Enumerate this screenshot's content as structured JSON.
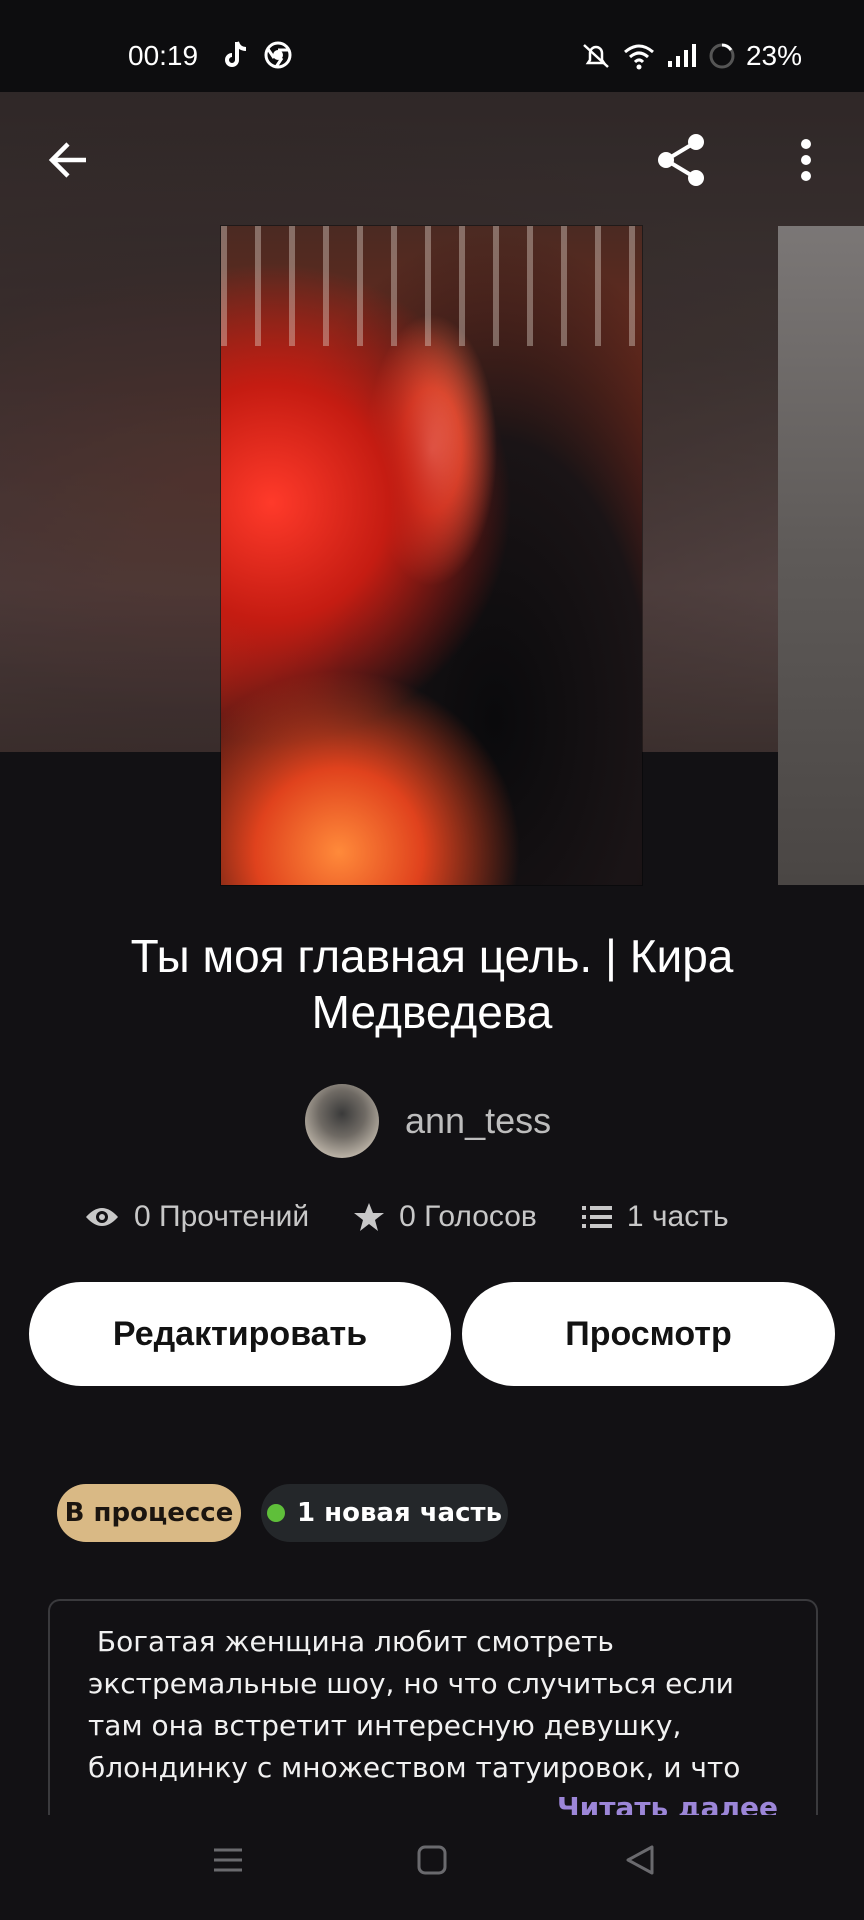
{
  "status_bar": {
    "time": "00:19",
    "battery": "23%"
  },
  "story": {
    "title": "Ты моя главная цель. | Кира Медведева",
    "author": "ann_tess",
    "reads": "0 Прочтений",
    "votes": "0 Голосов",
    "parts": "1 часть",
    "description": " Богатая женщина любит смотреть экстремальные шоу, но что случиться если там она встретит интересную девушку, блондинку с множеством татуировок, и что",
    "read_more": "Читать далее"
  },
  "actions": {
    "edit": "Редактировать",
    "view": "Просмотр"
  },
  "badges": {
    "status": "В процессе",
    "new_parts": "1 новая часть"
  },
  "icons": {
    "back": "arrow-left-icon",
    "share": "share-icon",
    "more": "more-vert-icon",
    "reads": "eye-icon",
    "votes": "star-icon",
    "parts": "list-icon"
  },
  "colors": {
    "background": "#121114",
    "status_badge": "#d9b985",
    "new_dot": "#5fbf3a",
    "read_more": "#9c86d8"
  }
}
